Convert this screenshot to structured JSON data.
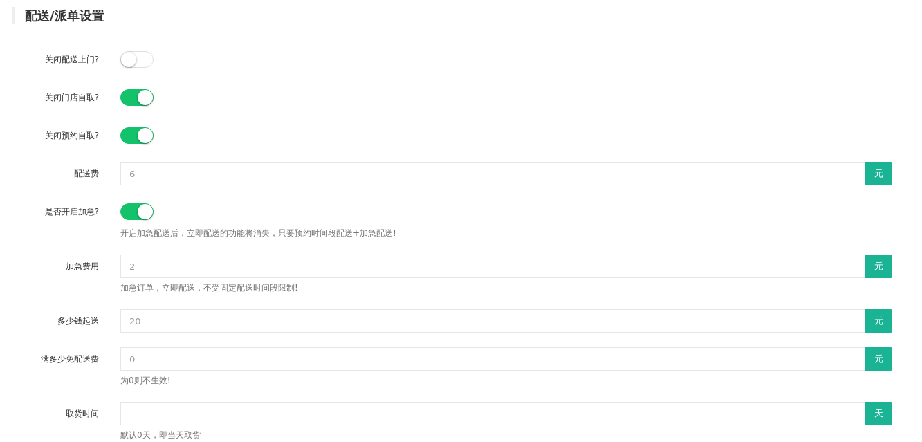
{
  "title": "配送/派单设置",
  "rows": [
    {
      "kind": "toggle",
      "label": "关闭配送上门?",
      "on": false
    },
    {
      "kind": "toggle",
      "label": "关闭门店自取?",
      "on": true
    },
    {
      "kind": "toggle",
      "label": "关闭预约自取?",
      "on": true
    },
    {
      "kind": "input",
      "label": "配送费",
      "value": "6",
      "addon": "元"
    },
    {
      "kind": "toggle",
      "label": "是否开启加急?",
      "on": true,
      "help": "开启加急配送后，立即配送的功能将消失，只要预约时间段配送+加急配送!"
    },
    {
      "kind": "input",
      "label": "加急费用",
      "value": "2",
      "addon": "元",
      "help": "加急订单，立即配送，不受固定配送时间段限制!"
    },
    {
      "kind": "input",
      "label": "多少钱起送",
      "value": "20",
      "addon": "元"
    },
    {
      "kind": "input",
      "label": "满多少免配送费",
      "value": "0",
      "addon": "元",
      "help": "为0则不生效!"
    },
    {
      "kind": "input",
      "label": "取货时间",
      "addon": "天",
      "help": "默认0天，即当天取货"
    }
  ]
}
